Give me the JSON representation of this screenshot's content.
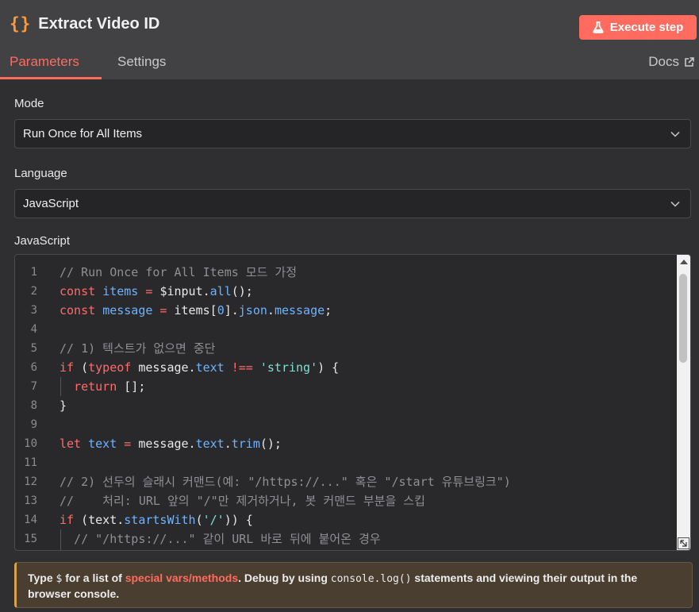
{
  "node": {
    "icon": "braces-icon",
    "icon_glyph": "{}",
    "title": "Extract Video ID",
    "execute_label": "Execute step"
  },
  "tabs": {
    "parameters": "Parameters",
    "settings": "Settings",
    "docs": "Docs"
  },
  "mode": {
    "label": "Mode",
    "value": "Run Once for All Items"
  },
  "language": {
    "label": "Language",
    "value": "JavaScript"
  },
  "editor": {
    "label": "JavaScript",
    "lines": [
      {
        "n": "1",
        "tokens": [
          [
            "c",
            "// Run Once for All Items 모드 가정"
          ]
        ]
      },
      {
        "n": "2",
        "tokens": [
          [
            "k",
            "const "
          ],
          [
            "v",
            "items"
          ],
          [
            "k",
            " = "
          ],
          [
            "",
            "$input."
          ],
          [
            "v",
            "all"
          ],
          [
            "",
            "();"
          ]
        ]
      },
      {
        "n": "3",
        "tokens": [
          [
            "k",
            "const "
          ],
          [
            "v",
            "message"
          ],
          [
            "k",
            " = "
          ],
          [
            "",
            "items["
          ],
          [
            "v",
            "0"
          ],
          [
            "",
            "]."
          ],
          [
            "v",
            "json"
          ],
          [
            "",
            "."
          ],
          [
            "v",
            "message"
          ],
          [
            "",
            ";"
          ]
        ]
      },
      {
        "n": "4",
        "tokens": []
      },
      {
        "n": "5",
        "tokens": [
          [
            "c",
            "// 1) 텍스트가 없으면 중단"
          ]
        ]
      },
      {
        "n": "6",
        "tokens": [
          [
            "k",
            "if "
          ],
          [
            "",
            "("
          ],
          [
            "k",
            "typeof "
          ],
          [
            "",
            "message."
          ],
          [
            "v",
            "text"
          ],
          [
            "k",
            " !== "
          ],
          [
            "s",
            "'string'"
          ],
          [
            "",
            ") {"
          ]
        ]
      },
      {
        "n": "7",
        "tokens": [
          [
            "",
            "  "
          ],
          [
            "k",
            "return "
          ],
          [
            "",
            "[];"
          ]
        ]
      },
      {
        "n": "8",
        "tokens": [
          [
            "",
            "}"
          ]
        ]
      },
      {
        "n": "9",
        "tokens": []
      },
      {
        "n": "10",
        "tokens": [
          [
            "k",
            "let "
          ],
          [
            "v",
            "text"
          ],
          [
            "k",
            " = "
          ],
          [
            "",
            "message."
          ],
          [
            "v",
            "text"
          ],
          [
            "",
            "."
          ],
          [
            "v",
            "trim"
          ],
          [
            "",
            "();"
          ]
        ]
      },
      {
        "n": "11",
        "tokens": []
      },
      {
        "n": "12",
        "tokens": [
          [
            "c",
            "// 2) 선두의 슬래시 커맨드(예: \"/https://...\" 혹은 \"/start 유튜브링크\")"
          ]
        ]
      },
      {
        "n": "13",
        "tokens": [
          [
            "c",
            "//    처리: URL 앞의 \"/\"만 제거하거나, 봇 커맨드 부분을 스킵"
          ]
        ]
      },
      {
        "n": "14",
        "tokens": [
          [
            "k",
            "if "
          ],
          [
            "",
            "(text."
          ],
          [
            "v",
            "startsWith"
          ],
          [
            "",
            "("
          ],
          [
            "s",
            "'/'"
          ],
          [
            "",
            ")) {"
          ]
        ]
      },
      {
        "n": "15",
        "tokens": [
          [
            "",
            "  "
          ],
          [
            "c",
            "// \"/https://...\" 같이 URL 바로 뒤에 붙어온 경우"
          ]
        ]
      }
    ]
  },
  "hint": {
    "prefix": "Type ",
    "dollar": "$",
    "mid": " for a list of ",
    "link": "special vars/methods",
    "after_link": ". Debug by using ",
    "code": "console.log()",
    "suffix": " statements and viewing their output in the browser console."
  },
  "colors": {
    "accent": "#ff6b5f",
    "icon_orange": "#ff9a3a",
    "comment": "#8f8f94",
    "keyword": "#ff6b6b",
    "identifier": "#6db3ff",
    "string": "#7ee0d0"
  }
}
